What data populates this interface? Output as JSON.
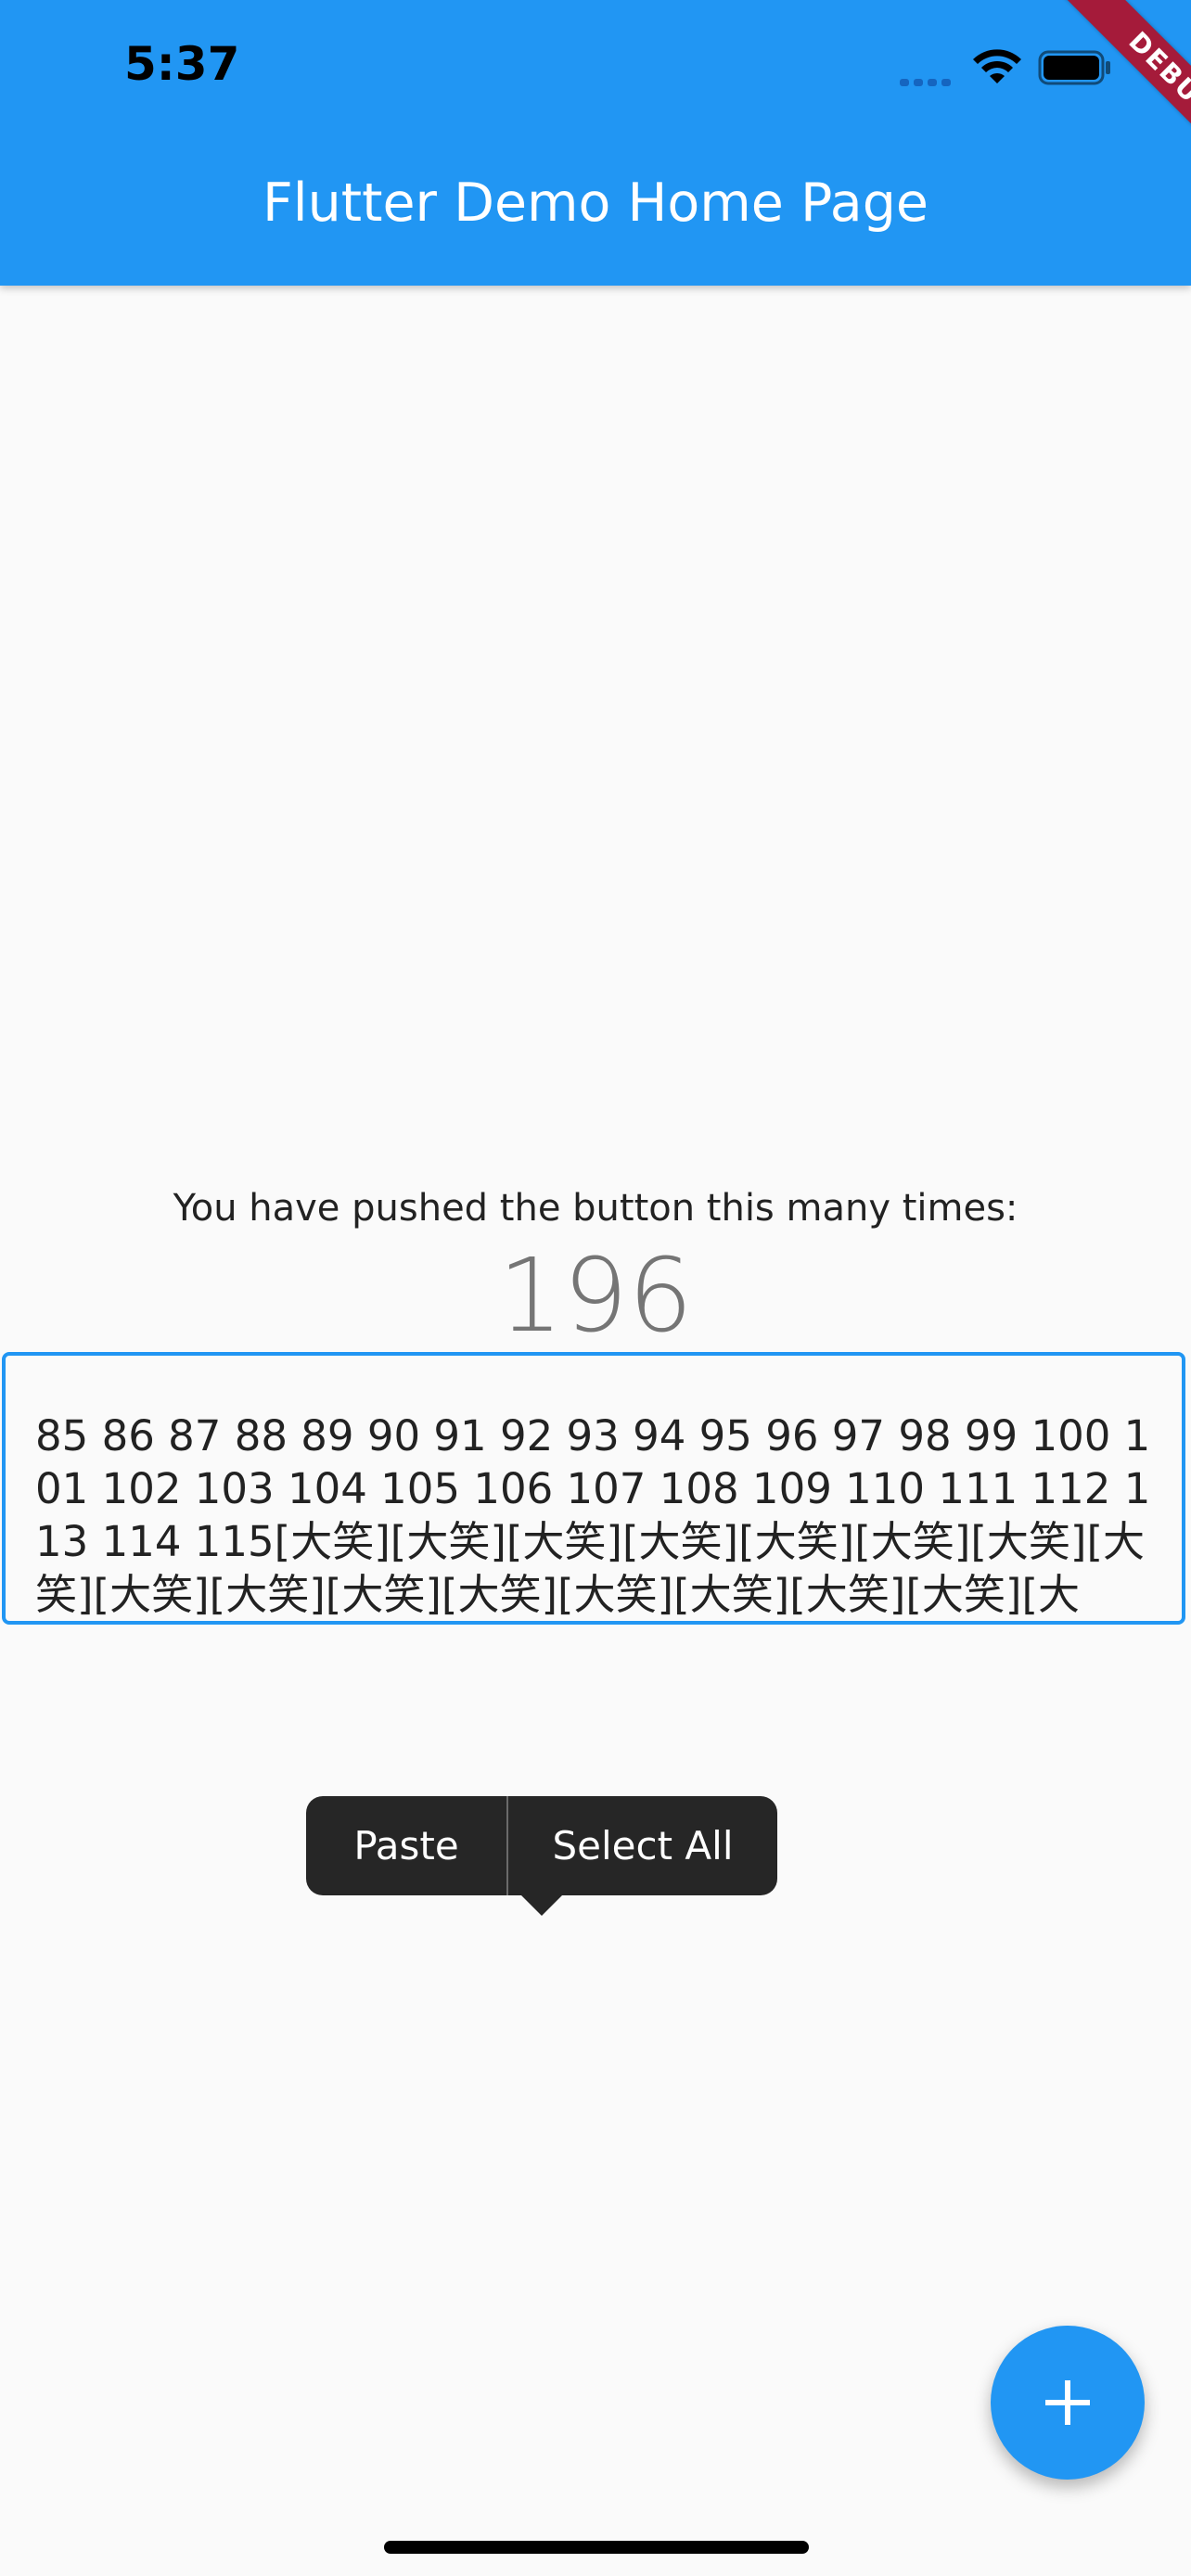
{
  "status_bar": {
    "time": "5:37",
    "icons": [
      "cellular-signal-icon",
      "wifi-icon",
      "battery-icon"
    ]
  },
  "app_bar": {
    "title": "Flutter Demo Home Page",
    "background_color": "#2196f3"
  },
  "debug_banner": {
    "label": "DEBUG",
    "color": "#a51b3a"
  },
  "main": {
    "caption": "You have pushed the button this many times:",
    "counter": "196"
  },
  "text_field": {
    "value": "85 86 87 88 89 90 91 92 93 94 95 96 97 98 99 100 101 102 103 104 105 106 107 108 109 110 111 112 113 114 115[大笑][大笑][大笑][大笑][大笑][大笑][大笑][大笑][大笑][大笑][大笑][大笑][大笑][大笑][大笑][大笑][大",
    "border_color": "#2196f3"
  },
  "context_menu": {
    "items": [
      {
        "label": "Paste"
      },
      {
        "label": "Select All"
      }
    ]
  },
  "fab": {
    "icon": "plus-icon",
    "color": "#2196f3"
  }
}
